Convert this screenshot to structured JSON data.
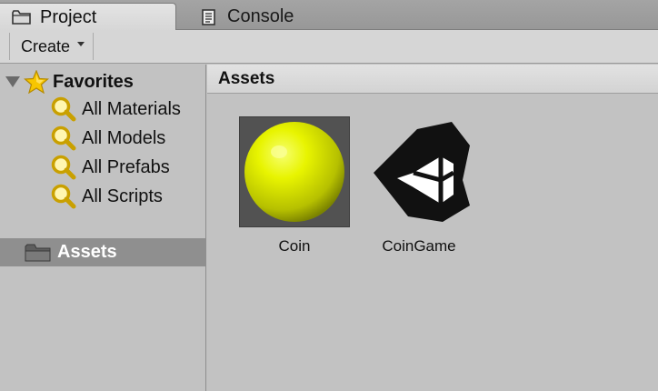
{
  "tabs": [
    {
      "label": "Project",
      "icon": "folder-icon",
      "active": true
    },
    {
      "label": "Console",
      "icon": "console-icon",
      "active": false
    }
  ],
  "toolbar": {
    "create_label": "Create"
  },
  "favorites": {
    "label": "Favorites",
    "items": [
      {
        "label": "All Materials"
      },
      {
        "label": "All Models"
      },
      {
        "label": "All Prefabs"
      },
      {
        "label": "All Scripts"
      }
    ]
  },
  "tree": {
    "assets_label": "Assets"
  },
  "content": {
    "breadcrumb": "Assets",
    "assets": [
      {
        "name": "Coin",
        "icon": "sphere-material-icon"
      },
      {
        "name": "CoinGame",
        "icon": "unity-scene-icon"
      }
    ]
  },
  "colors": {
    "selection": "#8f8f8f",
    "panel_bg": "#c2c2c2",
    "coin_yellow": "#e6f000"
  }
}
